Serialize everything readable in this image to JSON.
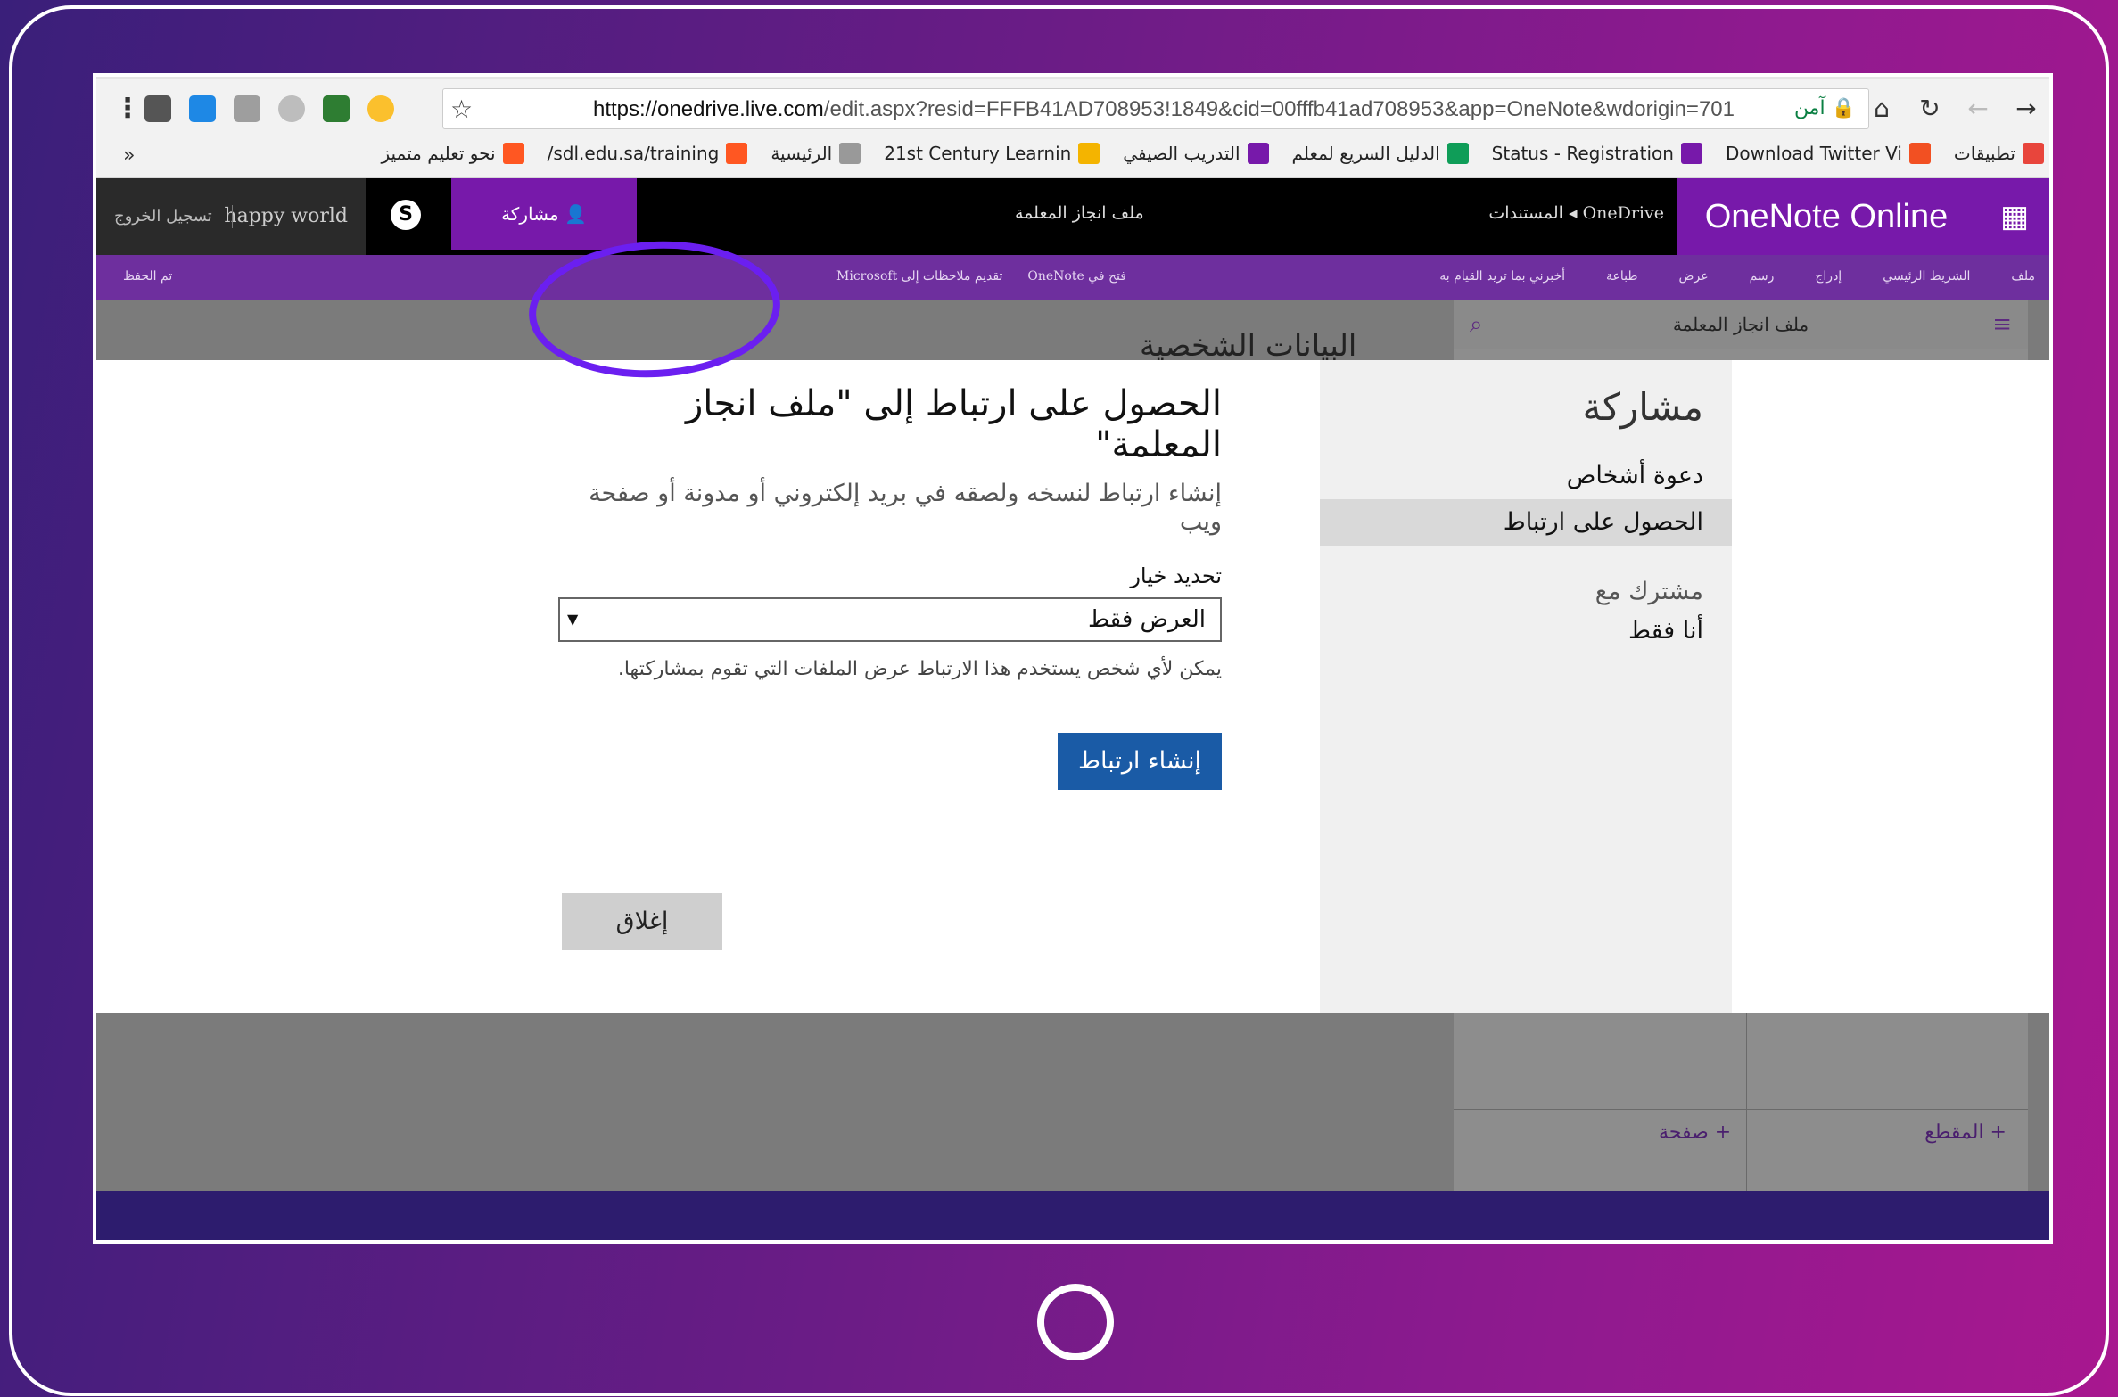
{
  "browser": {
    "url_host": "https://onedrive.live.com",
    "url_path": "/edit.aspx?resid=FFFB41AD708953!1849&cid=00fffb41ad708953&app=OneNote&wdorigin=701",
    "secure_label": "آمن",
    "bookmarks": [
      {
        "label": "تطبيقات",
        "icon": "apps-grid-icon",
        "color": "#e8453c"
      },
      {
        "label": "Download Twitter Vi",
        "icon": "windows-icon",
        "color": "#f25022"
      },
      {
        "label": "Status - Registration",
        "icon": "onenote-icon",
        "color": "#7719aa"
      },
      {
        "label": "الدليل السريع لمعلم",
        "icon": "classroom-icon",
        "color": "#0f9d58"
      },
      {
        "label": "التدريب الصيفي",
        "icon": "onenote-icon",
        "color": "#7719aa"
      },
      {
        "label": "21st Century Learnin",
        "icon": "dots-icon",
        "color": "#f4b400"
      },
      {
        "label": "الرئيسية",
        "icon": "page-icon",
        "color": "#999999"
      },
      {
        "label": "sdl.edu.sa/training/",
        "icon": "blogger-icon",
        "color": "#ff5722"
      },
      {
        "label": "نحو تعليم متميز",
        "icon": "blogger-icon",
        "color": "#ff5722"
      }
    ],
    "more_label": "»"
  },
  "onenote": {
    "app_name": "OneNote Online",
    "breadcrumb": "OneDrive ◂ المستندات",
    "doc_title": "ملف انجاز المعلمة",
    "share_label": "مشاركة",
    "user_name": "happy world",
    "signout_label": "تسجيل الخروج",
    "ribbon_tabs": [
      "ملف",
      "الشريط الرئيسي",
      "إدراج",
      "رسم",
      "عرض",
      "طباعة",
      "أخبرني بما تريد القيام به"
    ],
    "ribbon_mid": [
      "فتح في OneNote",
      "تقديم ملاحظات إلى Microsoft"
    ],
    "saved_label": "تم الحفظ",
    "nav_title": "ملف انجاز المعلمة",
    "page_peek": "البيانات الشخصية",
    "add_page": "+ صفحة",
    "add_section": "+ المقطع"
  },
  "modal": {
    "side_title": "مشاركة",
    "side_items": [
      "دعوة أشخاص",
      "الحصول على ارتباط"
    ],
    "shared_with_label": "مشترك مع",
    "shared_with_value": "أنا فقط",
    "title": "الحصول على ارتباط إلى \"ملف انجاز المعلمة\"",
    "description": "إنشاء ارتباط لنسخه ولصقه في بريد إلكتروني أو مدونة أو صفحة ويب",
    "select_label": "تحديد خيار",
    "select_value": "العرض فقط",
    "note": "يمكن لأي شخص يستخدم هذا الارتباط عرض الملفات التي تقوم بمشاركتها.",
    "create_button": "إنشاء ارتباط",
    "close_button": "إغلاق"
  },
  "colors": {
    "onenote_purple": "#7719aa",
    "annotation": "#6b1ff0",
    "create_button": "#1a5ba6"
  }
}
